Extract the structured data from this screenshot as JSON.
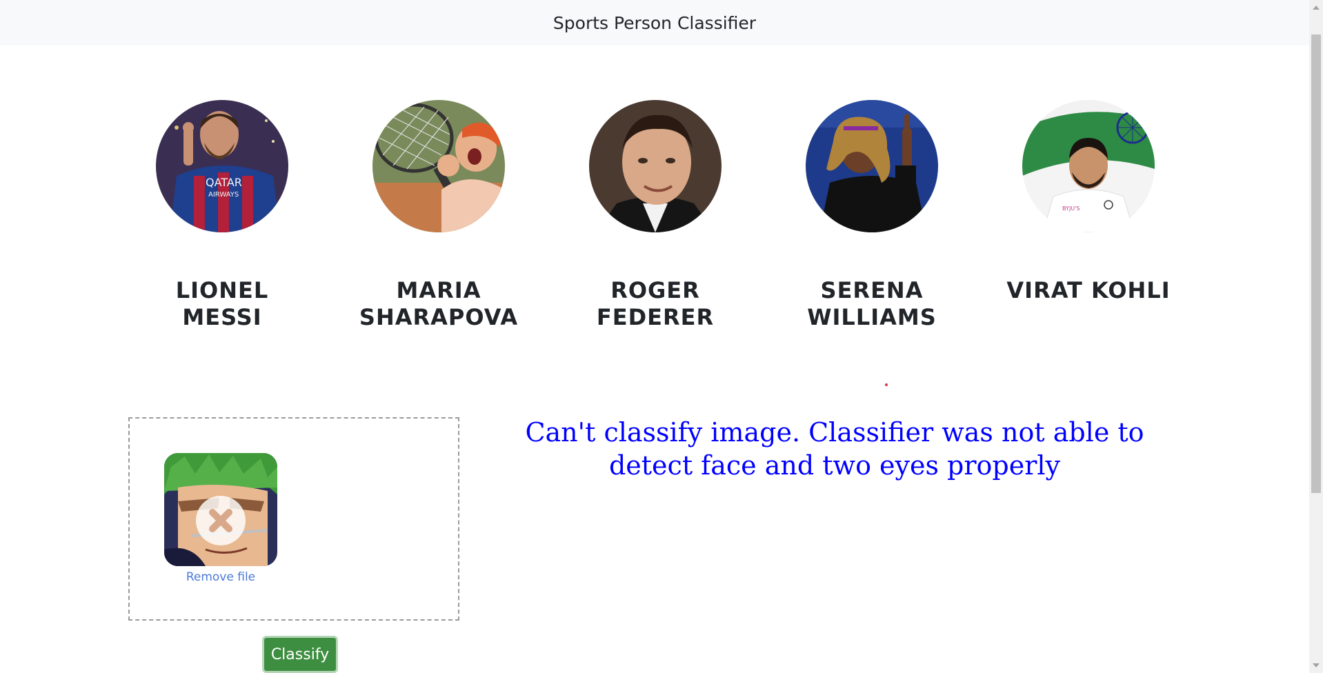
{
  "navbar": {
    "title": "Sports Person Classifier"
  },
  "players": [
    {
      "name": "LIONEL MESSI",
      "line1": "LIONEL",
      "line2": "MESSI",
      "icon": "messi-photo"
    },
    {
      "name": "MARIA SHARAPOVA",
      "line1": "MARIA",
      "line2": "SHARAPOVA",
      "icon": "sharapova-photo"
    },
    {
      "name": "ROGER FEDERER",
      "line1": "ROGER",
      "line2": "FEDERER",
      "icon": "federer-photo"
    },
    {
      "name": "SERENA WILLIAMS",
      "line1": "SERENA",
      "line2": "WILLIAMS",
      "icon": "serena-photo"
    },
    {
      "name": "VIRAT KOHLI",
      "line1": "VIRAT KOHLI",
      "line2": "",
      "icon": "kohli-photo"
    }
  ],
  "upload": {
    "remove_label": "Remove file",
    "status": "error"
  },
  "classify_button": {
    "label": "Classify"
  },
  "error_message": {
    "text": "Can't classify image. Classifier was not able to detect face and two eyes properly",
    "color": "#0000ff"
  },
  "colors": {
    "navbar_bg": "#f8f9fa",
    "button_bg": "#3e8e41",
    "link": "#4a79d9"
  }
}
